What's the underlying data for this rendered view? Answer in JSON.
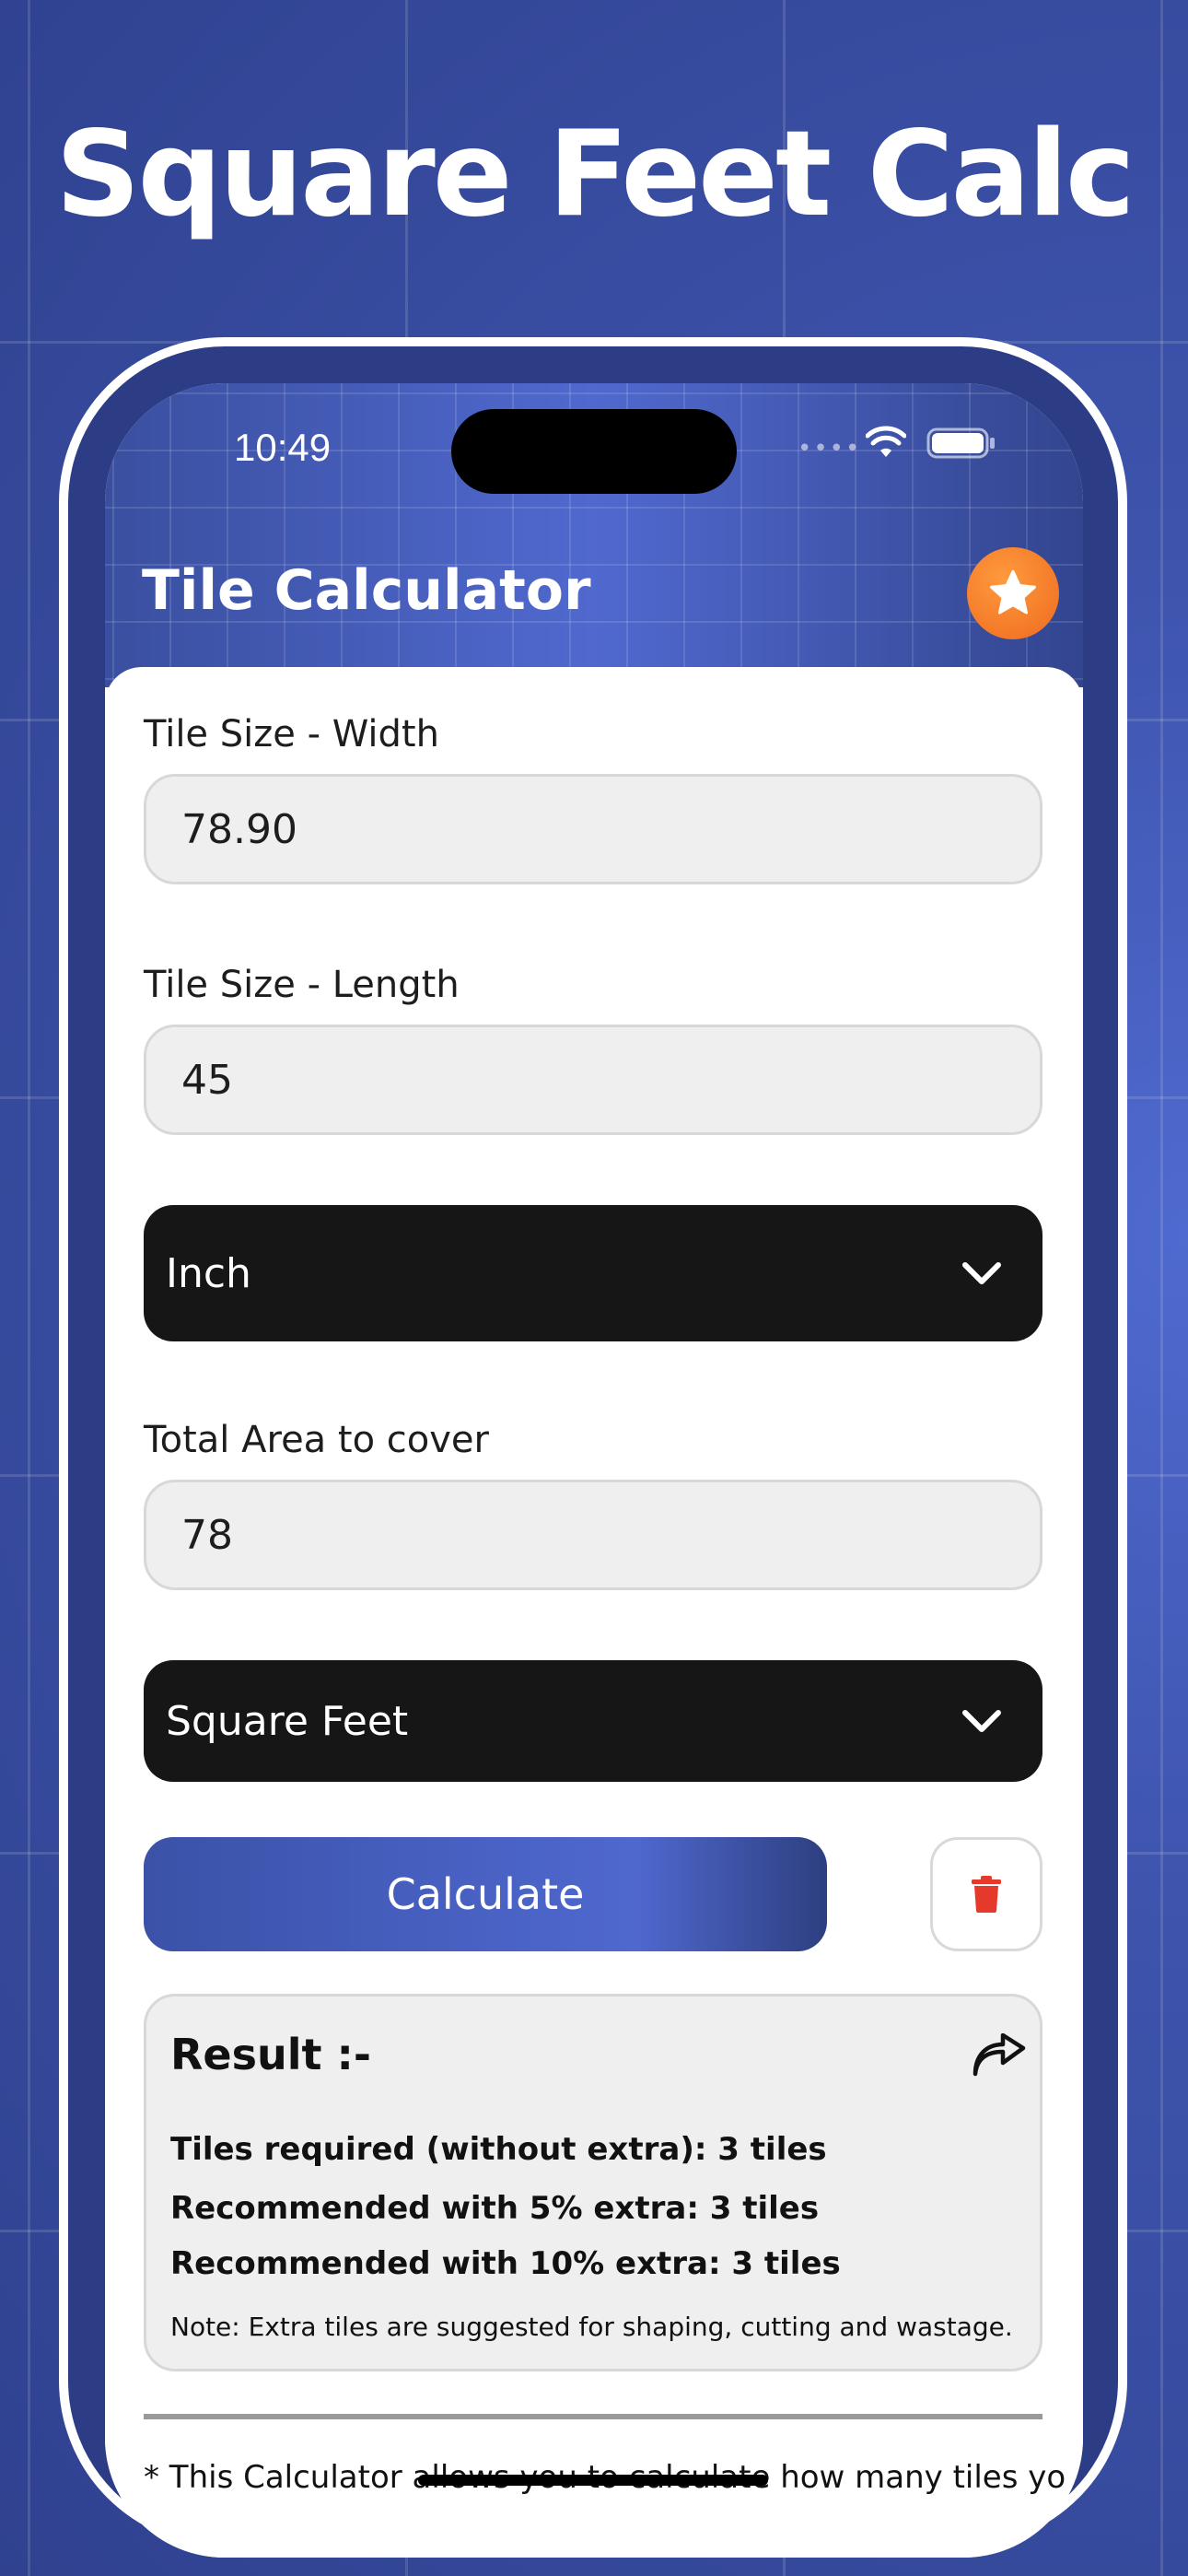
{
  "promo": {
    "title": "Square Feet Calc"
  },
  "status_bar": {
    "time": "10:49",
    "icons": [
      "signal-dots-icon",
      "wifi-icon",
      "battery-icon"
    ]
  },
  "header": {
    "title": "Tile Calculator",
    "action_icon": "star-icon"
  },
  "form": {
    "width_label": "Tile Size - Width",
    "width_value": "78.90",
    "length_label": "Tile Size - Length",
    "length_value": "45",
    "unit_select": "Inch",
    "area_label": "Total Area to cover",
    "area_value": "78",
    "area_unit_select": "Square Feet",
    "calculate_label": "Calculate",
    "delete_icon": "trash-icon"
  },
  "result": {
    "title": "Result :-",
    "share_icon": "share-icon",
    "line1": "Tiles required (without extra): 3 tiles",
    "line2": "Recommended with 5% extra: 3 tiles",
    "line3": "Recommended with 10% extra: 3 tiles",
    "note": "Note: Extra tiles are suggested for shaping, cutting and wastage."
  },
  "footer": {
    "text": "* This Calculator allows you to calculate how many tiles you"
  },
  "colors": {
    "brand_blue": "#4a62c4",
    "dark_select": "#161616",
    "delete_red": "#e5392c",
    "star_orange": "#f07a27"
  }
}
